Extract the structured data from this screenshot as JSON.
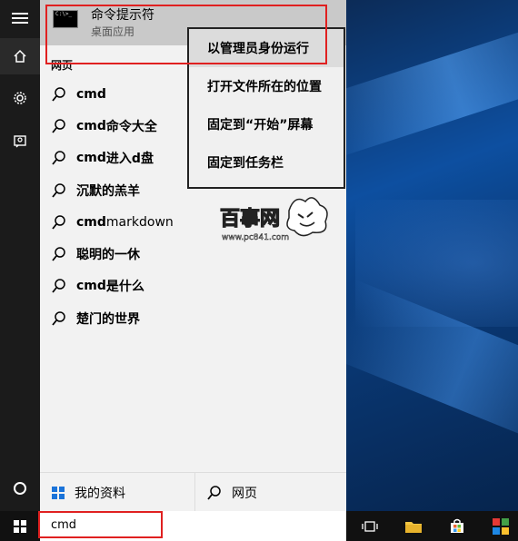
{
  "start_menu": {
    "best_match": {
      "title": "命令提示符",
      "subtitle": "桌面应用",
      "icon": "cmd-icon"
    },
    "section_label": "网页",
    "results": [
      {
        "bold": "cmd",
        "rest": ""
      },
      {
        "bold": "cmd",
        "rest": "命令大全"
      },
      {
        "bold": "cmd",
        "rest": " 进入d盘"
      },
      {
        "bold": "",
        "rest": "沉默的羔羊"
      },
      {
        "bold": "cmd",
        "rest": " markdown"
      },
      {
        "bold": "",
        "rest": "聪明的一休"
      },
      {
        "bold": "cmd",
        "rest": "是什么"
      },
      {
        "bold": "",
        "rest": "楚门的世界"
      }
    ],
    "bottom": {
      "my_stuff": "我的资料",
      "web": "网页"
    }
  },
  "context_menu": {
    "items": [
      "以管理员身份运行",
      "打开文件所在的位置",
      "固定到“开始”屏幕",
      "固定到任务栏"
    ]
  },
  "search": {
    "value": "cmd"
  },
  "watermark": {
    "brand": "百事网",
    "url": "www.pc841.com"
  },
  "colors": {
    "highlight": "#e02020",
    "rail": "#1b1b1b",
    "panel": "#f2f2f2"
  }
}
